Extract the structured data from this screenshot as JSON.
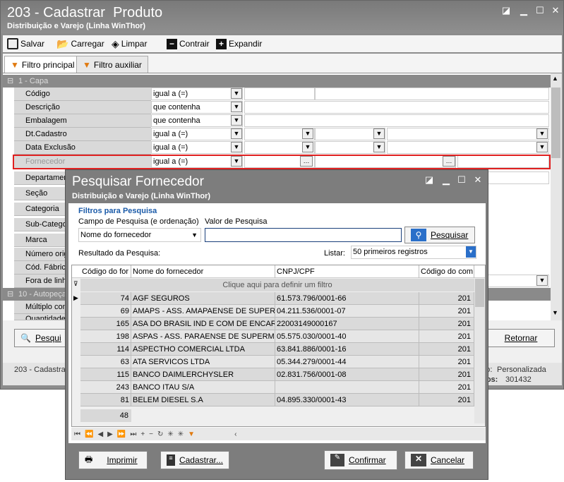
{
  "window": {
    "title": "203 - Cadastrar  Produto",
    "subtitle": "Distribuição e Varejo (Linha WinThor)"
  },
  "toolbar": {
    "salvar": "Salvar",
    "carregar": "Carregar",
    "limpar": "Limpar",
    "contrair": "Contrair",
    "expandir": "Expandir"
  },
  "tabs": {
    "principal": "Filtro principal",
    "auxiliar": "Filtro auxiliar"
  },
  "sections": {
    "capa": "1 - Capa",
    "autopecas": "10 - Autopeça"
  },
  "fields": [
    {
      "label": "Código",
      "op": "igual a (=)"
    },
    {
      "label": "Descrição",
      "op": "que contenha"
    },
    {
      "label": "Embalagem",
      "op": "que contenha"
    },
    {
      "label": "Dt.Cadastro",
      "op": "igual a (=)"
    },
    {
      "label": "Data Exclusão",
      "op": "igual a (=)"
    },
    {
      "label": "Fornecedor",
      "op": "igual a (=)"
    },
    {
      "label": "Departamen"
    },
    {
      "label": "Seção"
    },
    {
      "label": "Categoria"
    },
    {
      "label": "Sub-Catego"
    },
    {
      "label": "Marca"
    },
    {
      "label": "Número orig"
    },
    {
      "label": "Cód. Fábric"
    },
    {
      "label": "Fora de linh"
    }
  ],
  "autopecas_fields": [
    {
      "label": "Múltiplo com"
    },
    {
      "label": "Quantidade"
    }
  ],
  "bottom": {
    "pesquisar": "Pesqui",
    "retornar": "Retornar"
  },
  "status": {
    "left": "203 - Cadastra",
    "right_label1": "ário:",
    "right_value1": "Personalizada",
    "right_label2": "ados:",
    "right_value2": "301432"
  },
  "dialog": {
    "title": "Pesquisar Fornecedor",
    "subtitle": "Distribuição e Varejo (Linha WinThor)",
    "filters_title": "Filtros para Pesquisa",
    "campo_label": "Campo de Pesquisa (e ordenação)",
    "campo_value": "Nome do fornecedor",
    "valor_label": "Valor de Pesquisa",
    "valor_value": "",
    "pesquisar": "Pesquisar",
    "resultado": "Resultado da Pesquisa:",
    "listar_label": "Listar:",
    "listar_value": "50 primeiros registros",
    "columns": [
      "Código do for",
      "Nome do fornecedor",
      "CNPJ/CPF",
      "Código do com"
    ],
    "filter_hint": "Clique aqui para definir um filtro",
    "rows": [
      [
        "74",
        "AGF SEGUROS",
        "61.573.796/0001-66",
        "201"
      ],
      [
        "69",
        "AMAPS - ASS. AMAPAENSE DE SUPERMEF",
        "04.211.536/0001-07",
        "201"
      ],
      [
        "165",
        "ASA DO BRASIL IND E COM DE ENCART L",
        "22003149000167",
        "201"
      ],
      [
        "198",
        "ASPAS - ASS. PARAENSE DE SUPERMERC",
        "05.575.030/0001-40",
        "201"
      ],
      [
        "114",
        "ASPECTHO COMERCIAL LTDA",
        "63.841.886/0001-16",
        "201"
      ],
      [
        "63",
        "ATA SERVICOS LTDA",
        "05.344.279/0001-44",
        "201"
      ],
      [
        "115",
        "BANCO DAIMLERCHYSLER",
        "02.831.756/0001-08",
        "201"
      ],
      [
        "243",
        "BANCO ITAU S/A",
        "",
        "201"
      ],
      [
        "81",
        "BELEM DIESEL S.A",
        "04.895.330/0001-43",
        "201"
      ]
    ],
    "count": "48",
    "imprimir": "Imprimir",
    "cadastrar": "Cadastrar...",
    "confirmar": "Confirmar",
    "cancelar": "Cancelar"
  },
  "colors": {
    "title_bg": "#8a8a8a",
    "highlight": "#e02020",
    "search_blue": "#2a6fc9"
  }
}
